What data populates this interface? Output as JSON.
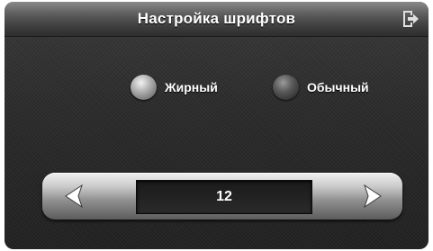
{
  "header": {
    "title": "Настройка шрифтов",
    "exit_icon": "exit-icon"
  },
  "font_style": {
    "options": [
      {
        "label": "Жирный",
        "selected": true
      },
      {
        "label": "Обычный",
        "selected": false
      }
    ]
  },
  "font_size": {
    "value": "12",
    "decrease_icon": "chevron-left-icon",
    "increase_icon": "chevron-right-icon"
  }
}
